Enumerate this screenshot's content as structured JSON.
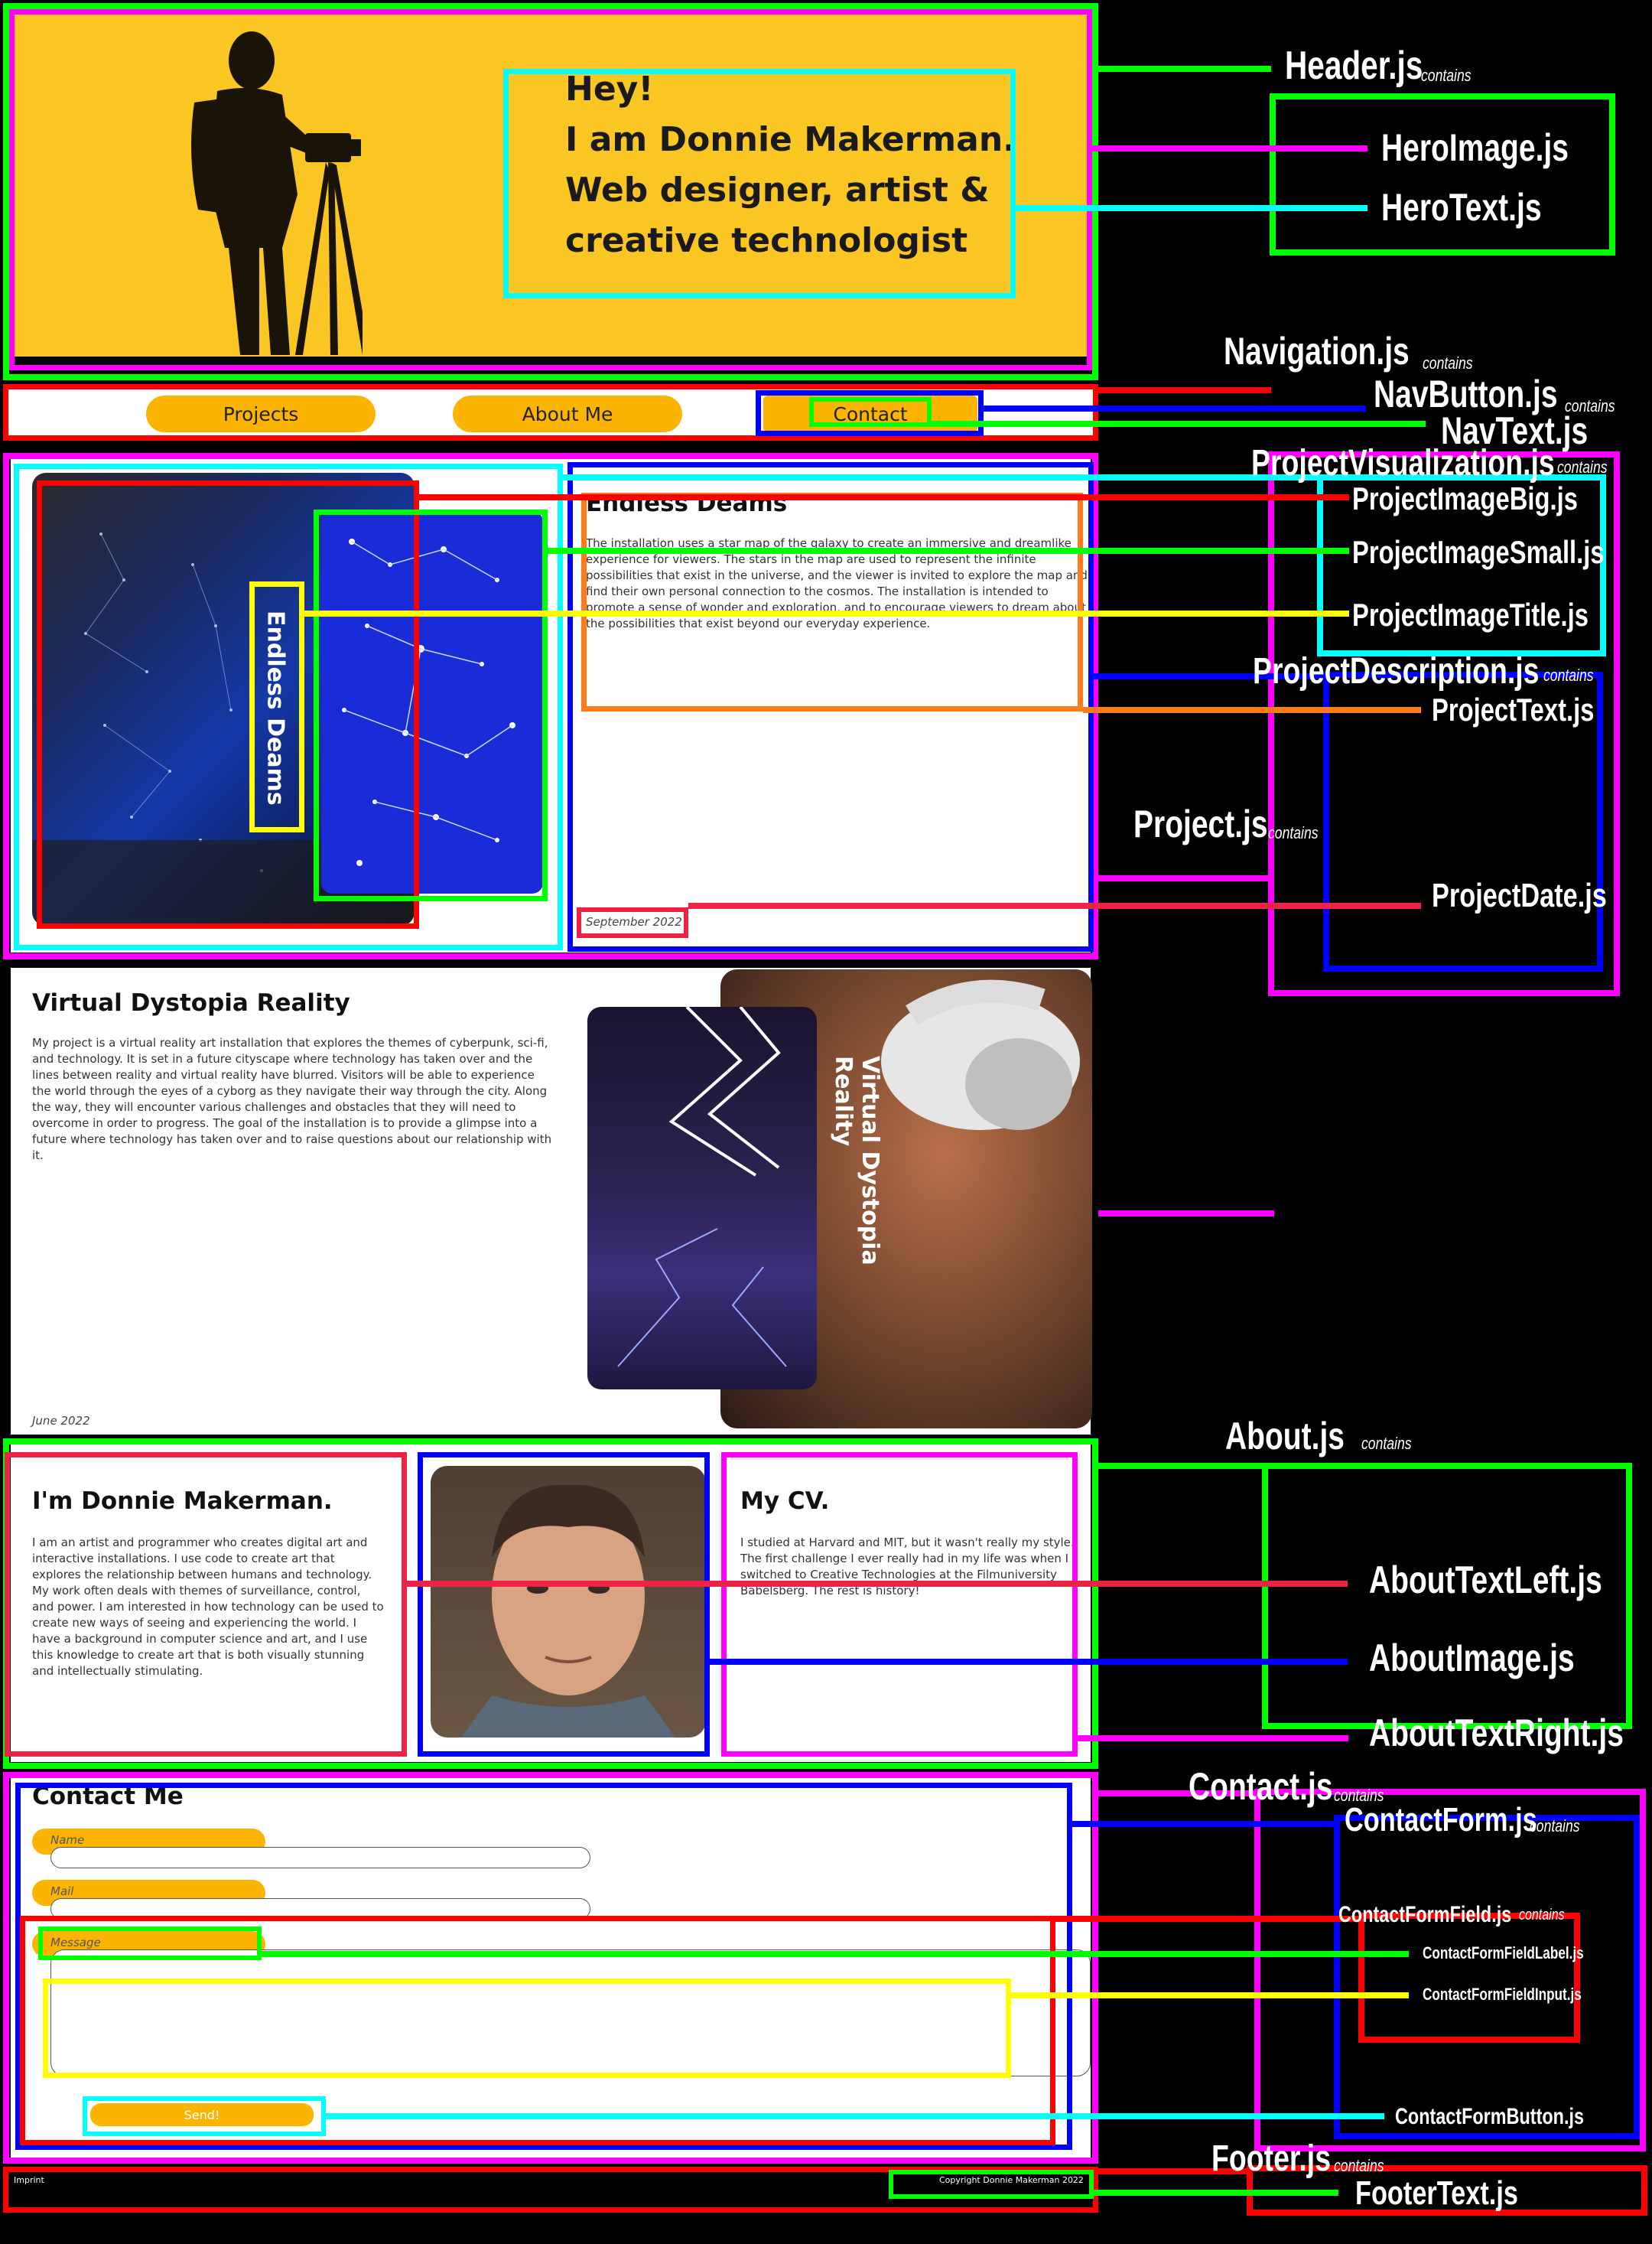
{
  "mockup": {
    "hero": {
      "line1": "Hey!",
      "line2": "I am Donnie Makerman.",
      "line3": "Web designer, artist &",
      "line4": "creative technologist"
    },
    "nav": {
      "items": [
        {
          "label": "Projects"
        },
        {
          "label": "About Me"
        },
        {
          "label": "Contact"
        }
      ]
    },
    "project1": {
      "title": "Endless Deams",
      "image_title": "Endless Deams",
      "text": "The installation uses a star map of the galaxy to create an immersive and dreamlike experience for viewers. The stars in the map are used to represent the infinite possibilities that exist in the universe, and the viewer is invited to explore the map and find their own personal connection to the cosmos. The installation is intended to promote a sense of wonder and exploration, and to encourage viewers to dream about the possibilities that exist beyond our everyday experience.",
      "date": "September 2022"
    },
    "project2": {
      "title": "Virtual Dystopia Reality",
      "image_title": "Virtual Dystopia Reality",
      "text": "My project is a virtual reality art installation that explores the themes of cyberpunk, sci-fi, and technology. It is set in a future cityscape where technology has taken over and the lines between reality and virtual reality have blurred. Visitors will be able to experience the world through the eyes of a cyborg as they navigate their way through the city. Along the way, they will encounter various challenges and obstacles that they will need to overcome in order to progress. The goal of the installation is to provide a glimpse into a future where technology has taken over and to raise questions about our relationship with it.",
      "date": "June 2022"
    },
    "about": {
      "left_title": "I'm Donnie Makerman.",
      "left_text": "I am an artist and programmer who creates digital art and interactive installations. I use code to create art that explores the relationship between humans and technology. My work often deals with themes of surveillance, control, and power. I am interested in how technology can be used to create new ways of seeing and experiencing the world. I have a background in computer science and art, and I use this knowledge to create art that is both visually stunning and intellectually stimulating.",
      "right_title": "My CV.",
      "right_text": "I studied at Harvard and MIT, but it wasn't really my style. The first challenge I ever really had in my life was when I switched to Creative Technologies at the Filmuniversity Babelsberg. The rest is history!"
    },
    "contact": {
      "title": "Contact Me",
      "fields": [
        {
          "label": "Name"
        },
        {
          "label": "Mail"
        },
        {
          "label": "Message"
        }
      ],
      "button": "Send!"
    },
    "footer": {
      "imprint": "Imprint",
      "copyright": "Copyright Donnie Makerman 2022"
    }
  },
  "labels": {
    "header": "Header.js",
    "hero_image": "HeroImage.js",
    "hero_text": "HeroText.js",
    "navigation": "Navigation.js",
    "nav_button": "NavButton.js",
    "nav_text": "NavText.js",
    "project_visualization": "ProjectVisualization.js",
    "project_image_big": "ProjectImageBig.js",
    "project_image_small": "ProjectImageSmall.js",
    "project_image_title": "ProjectImageTitle.js",
    "project_description": "ProjectDescription.js",
    "project_text": "ProjectText.js",
    "project": "Project.js",
    "project_date": "ProjectDate.js",
    "about": "About.js",
    "about_text_left": "AboutTextLeft.js",
    "about_image": "AboutImage.js",
    "about_text_right": "AboutTextRight.js",
    "contact": "Contact.js",
    "contact_form": "ContactForm.js",
    "contact_form_field": "ContactFormField.js",
    "contact_form_field_label": "ContactFormFieldLabel.js",
    "contact_form_field_input": "ContactFormFieldInput.js",
    "contact_form_button": "ContactFormButton.js",
    "footer": "Footer.js",
    "footer_text": "FooterText.js",
    "contains": "contains"
  },
  "colors": {
    "hero_bg": "#f9c623",
    "nav_button": "#fbb500",
    "green": "#00ff00",
    "magenta": "#ff00ff",
    "cyan": "#00ffff",
    "red": "#ff0000",
    "blue": "#0000ff",
    "yellow": "#ffff00",
    "orange": "#ff7a1a",
    "crimson": "#ee2244"
  }
}
